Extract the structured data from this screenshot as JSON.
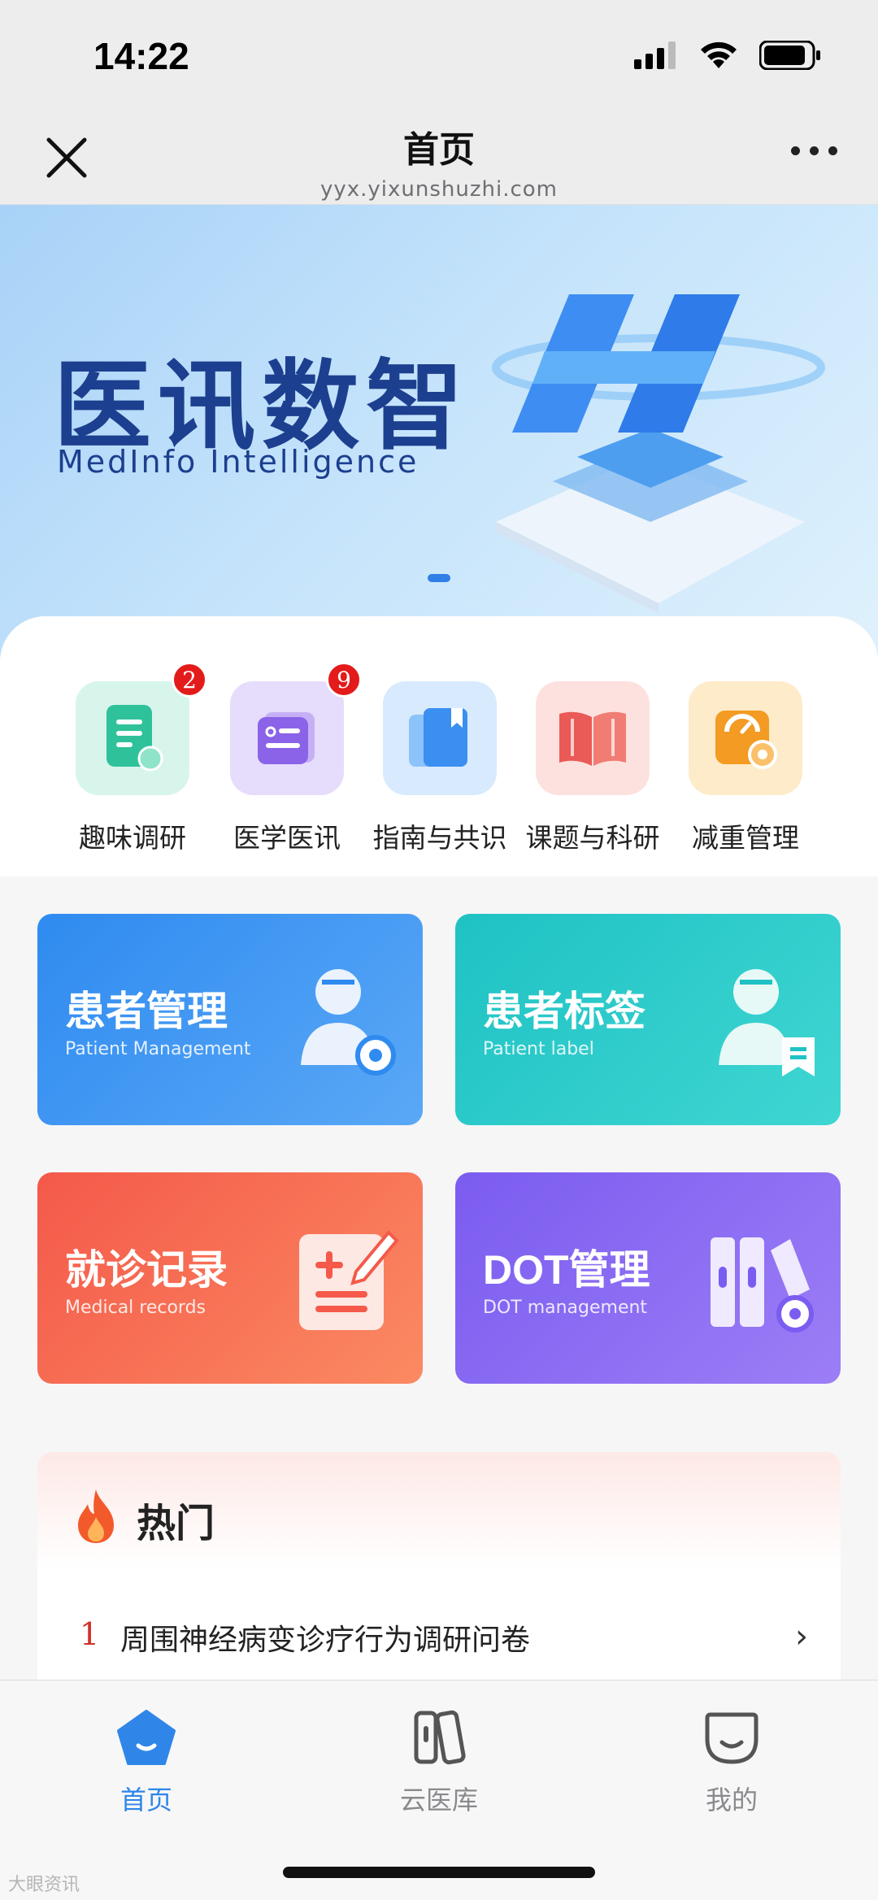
{
  "status_bar": {
    "time": "14:22"
  },
  "nav": {
    "title": "首页",
    "url": "yyx.yixunshuzhi.com"
  },
  "banner": {
    "title": "医讯数智",
    "subtitle": "MedInfo  Intelligence"
  },
  "quick_actions": [
    {
      "label": "趣味调研",
      "badge": "2",
      "icon": "survey-icon",
      "color": "#2fc29a"
    },
    {
      "label": "医学医讯",
      "badge": "9",
      "icon": "news-icon",
      "color": "#8b63e8"
    },
    {
      "label": "指南与共识",
      "badge": "",
      "icon": "guide-book-icon",
      "color": "#3a8ff0"
    },
    {
      "label": "课题与科研",
      "badge": "",
      "icon": "open-book-icon",
      "color": "#ea5a56"
    },
    {
      "label": "减重管理",
      "badge": "",
      "icon": "scale-gear-icon",
      "color": "#f39b22"
    }
  ],
  "features": [
    {
      "title": "患者管理",
      "subtitle": "Patient Management",
      "color_from": "#2f8bf0",
      "color_to": "#5aa8f6",
      "icon": "patient-gear-icon"
    },
    {
      "title": "患者标签",
      "subtitle": "Patient label",
      "color_from": "#1fc2c4",
      "color_to": "#3fd6d2",
      "icon": "patient-tag-icon"
    },
    {
      "title": "就诊记录",
      "subtitle": "Medical records",
      "color_from": "#f4594a",
      "color_to": "#fb8a62",
      "icon": "record-edit-icon"
    },
    {
      "title": "DOT管理",
      "subtitle": "DOT management",
      "color_from": "#7b5cf0",
      "color_to": "#9c7ef6",
      "icon": "binders-gear-icon"
    }
  ],
  "hot": {
    "title": "热门",
    "items": [
      {
        "num": "1",
        "text": "周围神经病变诊疗行为调研问卷"
      }
    ]
  },
  "tabs": [
    {
      "label": "首页",
      "icon": "home-pentagon-icon",
      "active": true
    },
    {
      "label": "云医库",
      "icon": "library-icon",
      "active": false
    },
    {
      "label": "我的",
      "icon": "profile-face-icon",
      "active": false
    }
  ],
  "watermark": "大眼资讯"
}
